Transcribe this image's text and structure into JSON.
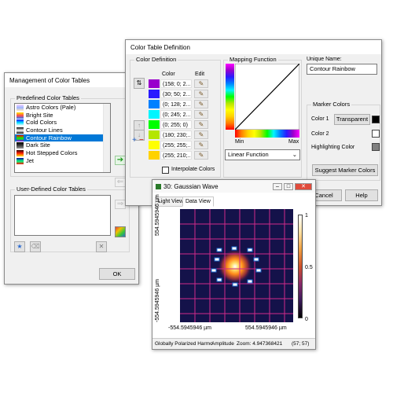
{
  "manage": {
    "title": "Management of Color Tables",
    "predefined_label": "Predefined Color Tables",
    "tables": [
      {
        "name": "Astro Colors (Pale)",
        "colors": [
          "#f4d3ff",
          "#9bb3ff",
          "#ffe9c2"
        ]
      },
      {
        "name": "Bright Site",
        "colors": [
          "#ffe800",
          "#ff4b4b",
          "#2f7cff"
        ]
      },
      {
        "name": "Cold Colors",
        "colors": [
          "#0010ff",
          "#00e0ff",
          "#ffffff"
        ]
      },
      {
        "name": "Contour Lines",
        "colors": [
          "#000000",
          "#ffffff",
          "#000000"
        ]
      },
      {
        "name": "Contour Rainbow",
        "colors": [
          "#ff0000",
          "#00ff00",
          "#8000ff"
        ]
      },
      {
        "name": "Dark Site",
        "colors": [
          "#000000",
          "#3a3a3a",
          "#9a9a9a"
        ]
      },
      {
        "name": "Hot Stepped Colors",
        "colors": [
          "#300000",
          "#ff2000",
          "#ffe000"
        ]
      },
      {
        "name": "Jet",
        "colors": [
          "#0000a0",
          "#00ff80",
          "#ff1000"
        ]
      }
    ],
    "selected_index": 4,
    "user_label": "User-Defined Color Tables",
    "ok": "OK"
  },
  "definition": {
    "title": "Color Table Definition",
    "color_def_label": "Color Definition",
    "col_color": "Color",
    "col_edit": "Edit",
    "rows": [
      {
        "color": "#9900cc",
        "value": "(158; 0; 2..."
      },
      {
        "color": "#2a1aff",
        "value": "(30; 50; 2..."
      },
      {
        "color": "#0080ff",
        "value": "(0; 128; 2..."
      },
      {
        "color": "#00f5ff",
        "value": "(0; 245; 2..."
      },
      {
        "color": "#00ff00",
        "value": "(0; 255; 0)"
      },
      {
        "color": "#b4e600",
        "value": "(180; 230;..."
      },
      {
        "color": "#ffff00",
        "value": "(255; 255;..."
      },
      {
        "color": "#ffd200",
        "value": "(255; 210;..."
      }
    ],
    "interpolate_label": "Interpolate Colors",
    "mapping_label": "Mapping Function",
    "min_label": "Min",
    "max_label": "Max",
    "mapping_select": "Linear Function",
    "unique_name_label": "Unique Name:",
    "unique_name_value": "Contour Rainbow",
    "marker_colors_label": "Marker Colors",
    "color1_label": "Color 1",
    "color1_btn": "Transparent",
    "color2_label": "Color 2",
    "highlight_label": "Highlighting Color",
    "suggest_btn": "Suggest Marker Colors",
    "cancel": "Cancel",
    "help": "Help"
  },
  "gauss": {
    "title": "30: Gaussian Wave",
    "tab_light": "Light View",
    "tab_data": "Data View",
    "y_top": "554.5945946 µm",
    "y_bottom": "-554.5945946 µm",
    "x_left": "-554.5945946 µm",
    "x_right": "554.5945946 µm",
    "cb_max": "1",
    "cb_mid": "0.5",
    "cb_min": "0",
    "status_field": "Globally Polarized Harmo",
    "status_amp": "Amplitude",
    "status_zoom": "Zoom: 4.947368421",
    "status_coord": "(57; 57)"
  }
}
